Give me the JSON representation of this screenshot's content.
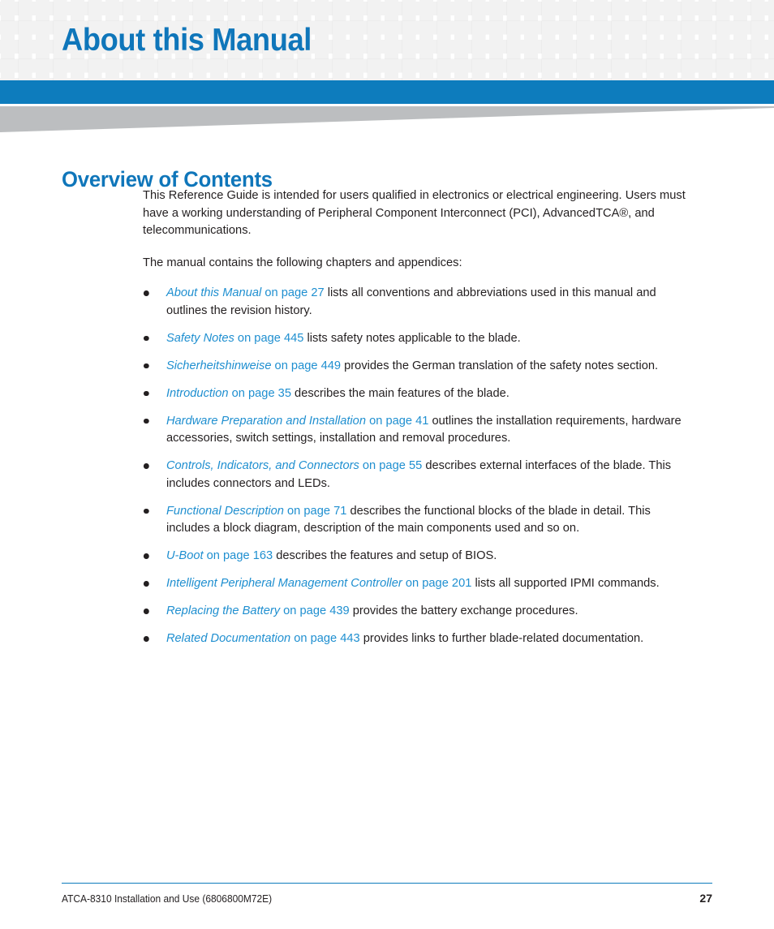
{
  "header": {
    "chapter_title": "About this Manual",
    "accent_color": "#0d7cbd",
    "grid_cell_color": "#f2f2f2",
    "wedge_color": "#bcbec0"
  },
  "section": {
    "heading": "Overview of Contents",
    "heading_color": "#0f76ba"
  },
  "paragraphs": [
    "This Reference Guide is intended for users qualified in electronics or electrical engineering. Users must have a working understanding of Peripheral Component Interconnect (PCI), AdvancedTCA®, and telecommunications.",
    "The manual contains the following chapters and appendices:"
  ],
  "link_color": "#1f8fd0",
  "bullets": [
    {
      "xref_title": "About this Manual",
      "xref_page": " on page 27",
      "rest": " lists all conventions and abbreviations used in this manual and outlines the revision history."
    },
    {
      "xref_title": "Safety Notes",
      "xref_page": " on page 445",
      "rest": " lists safety notes applicable to the blade."
    },
    {
      "xref_title": "Sicherheitshinweise",
      "xref_page": " on page 449",
      "rest": " provides the German translation of the safety notes section."
    },
    {
      "xref_title": "Introduction",
      "xref_page": " on page 35",
      "rest": " describes the main features of the blade."
    },
    {
      "xref_title": "Hardware Preparation and Installation",
      "xref_page": " on page 41",
      "rest": " outlines the installation requirements, hardware accessories, switch settings, installation and removal procedures."
    },
    {
      "xref_title": "Controls, Indicators, and Connectors",
      "xref_page": " on page 55",
      "rest": " describes external interfaces of the blade. This includes connectors and LEDs."
    },
    {
      "xref_title": " Functional Description",
      "xref_page": " on page 71",
      "rest": " describes the functional blocks of the blade in detail. This includes a block diagram, description of the main components used and so on."
    },
    {
      "xref_title": "U-Boot",
      "xref_page": " on page 163",
      "rest": " describes the features and setup of BIOS."
    },
    {
      "xref_title": "Intelligent Peripheral Management Controller",
      "xref_page": " on page 201",
      "rest": " lists all supported IPMI commands."
    },
    {
      "xref_title": "Replacing the Battery",
      "xref_page": " on page 439",
      "rest": " provides the battery exchange procedures."
    },
    {
      "xref_title": "Related Documentation",
      "xref_page": " on page 443",
      "rest": " provides links to further blade-related documentation."
    }
  ],
  "footer": {
    "document_title": "ATCA-8310 Installation and Use (6806800M72E)",
    "page_number": "27",
    "rule_color": "#0d7cbd"
  }
}
